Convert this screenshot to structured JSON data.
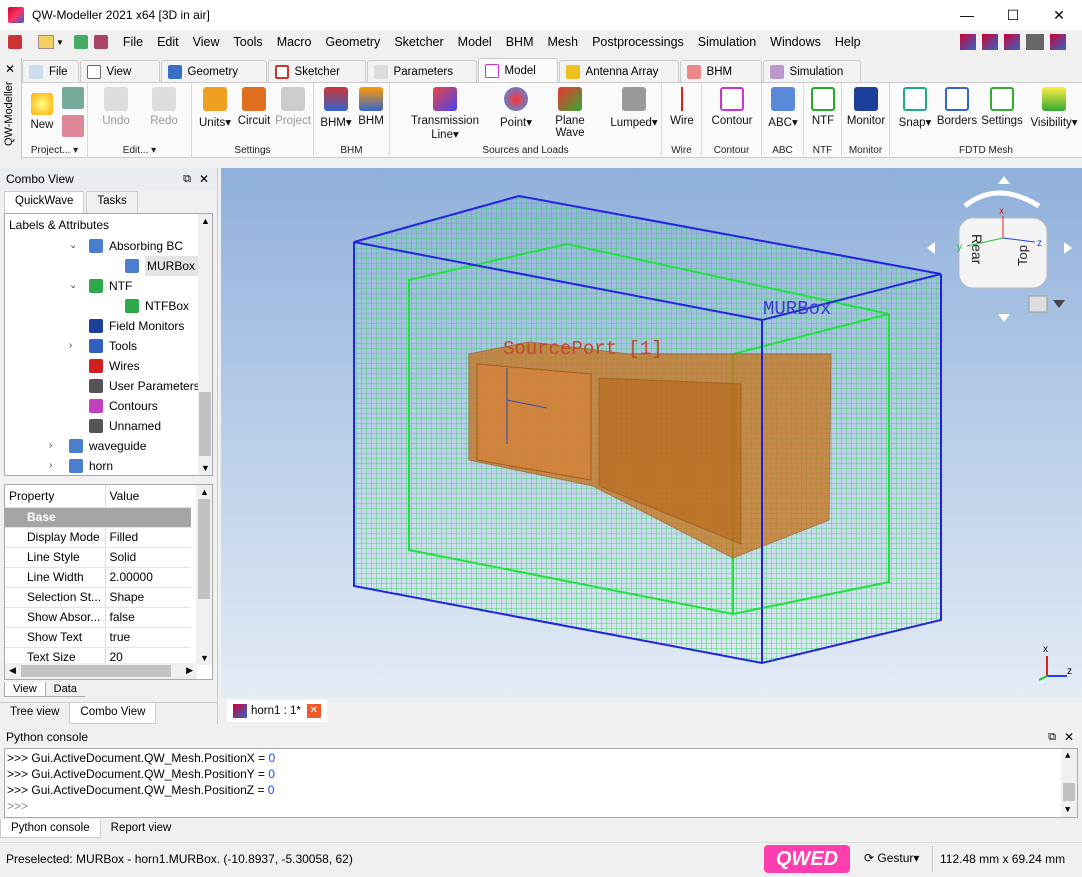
{
  "window": {
    "title": "QW-Modeller 2021 x64 [3D in air]"
  },
  "menu": [
    "File",
    "Edit",
    "View",
    "Tools",
    "Macro",
    "Geometry",
    "Sketcher",
    "Model",
    "BHM",
    "Mesh",
    "Postprocessings",
    "Simulation",
    "Windows",
    "Help"
  ],
  "ribbon_tabs": [
    "File",
    "View",
    "Geometry",
    "Sketcher",
    "Parameters",
    "Model",
    "Antenna Array",
    "BHM",
    "Simulation"
  ],
  "ribbon_active": "Model",
  "ribbon": {
    "project": {
      "new": "New",
      "label": "Project..."
    },
    "edit": {
      "undo": "Undo",
      "redo": "Redo",
      "label": "Edit..."
    },
    "settings": {
      "units": "Units",
      "circuit": "Circuit",
      "project": "Project",
      "label": "Settings"
    },
    "bhm": {
      "b1": "BHM",
      "b2": "BHM",
      "label": "BHM"
    },
    "sources": {
      "tl": "Transmission Line",
      "point": "Point",
      "plane": "Plane Wave",
      "lumped": "Lumped",
      "label": "Sources and Loads"
    },
    "wire": {
      "b": "Wire",
      "label": "Wire"
    },
    "contour": {
      "b": "Contour",
      "label": "Contour"
    },
    "abc": {
      "b": "ABC",
      "label": "ABC"
    },
    "ntf": {
      "b": "NTF",
      "label": "NTF"
    },
    "monitor": {
      "b": "Monitor",
      "label": "Monitor"
    },
    "fdtd": {
      "snap": "Snap",
      "borders": "Borders",
      "settings": "Settings",
      "visibility": "Visibility",
      "label": "FDTD Mesh"
    }
  },
  "sidebar_strip": "QW-Modeller",
  "combo": {
    "title": "Combo View",
    "tabs": [
      "QuickWave",
      "Tasks"
    ],
    "tree_header": "Labels & Attributes",
    "tree": [
      {
        "label": "Absorbing BC",
        "level": 1,
        "expanded": true,
        "color": "#4a7fd0"
      },
      {
        "label": "MURBox",
        "level": 2,
        "selected": true,
        "color": "#4a7fd0"
      },
      {
        "label": "NTF",
        "level": 1,
        "expanded": true,
        "color": "#2da84a"
      },
      {
        "label": "NTFBox",
        "level": 2,
        "color": "#2da84a"
      },
      {
        "label": "Field Monitors",
        "level": 1,
        "color": "#1c3f9a"
      },
      {
        "label": "Tools",
        "level": 1,
        "collapsed": true,
        "color": "#3060c0"
      },
      {
        "label": "Wires",
        "level": 1,
        "color": "#d02020"
      },
      {
        "label": "User Parameters",
        "level": 1,
        "color": "#555555"
      },
      {
        "label": "Contours",
        "level": 1,
        "color": "#c040c0"
      },
      {
        "label": "Unnamed",
        "level": 1,
        "color": "#555555"
      },
      {
        "label": "waveguide",
        "level": 0,
        "collapsed": true,
        "color": "#4a7fd0"
      },
      {
        "label": "horn",
        "level": 0,
        "collapsed": true,
        "color": "#4a7fd0"
      }
    ],
    "props_header": [
      "Property",
      "Value"
    ],
    "props_base": "Base",
    "props": [
      [
        "Display Mode",
        "Filled"
      ],
      [
        "Line Style",
        "Solid"
      ],
      [
        "Line Width",
        "2.00000"
      ],
      [
        "Selection St...",
        "Shape"
      ],
      [
        "Show Absor...",
        "false"
      ],
      [
        "Show Text",
        "true"
      ],
      [
        "Text Size",
        "20"
      ]
    ],
    "bottom_tabs": [
      "View",
      "Data"
    ],
    "panel_tabs": [
      "Tree view",
      "Combo View"
    ]
  },
  "viewport": {
    "label_murbox": "MURBox",
    "label_source": "SourcePort [1]",
    "navcube": {
      "rear": "Rear",
      "top": "Top"
    },
    "axes": {
      "x": "x",
      "y": "y",
      "z": "z"
    }
  },
  "document_tab": "horn1 : 1*",
  "console": {
    "title": "Python console",
    "prompt": ">>>",
    "lines": [
      {
        "code": "Gui.ActiveDocument.QW_Mesh.PositionX = ",
        "value": "0"
      },
      {
        "code": "Gui.ActiveDocument.QW_Mesh.PositionY = ",
        "value": "0"
      },
      {
        "code": "Gui.ActiveDocument.QW_Mesh.PositionZ = ",
        "value": "0"
      }
    ],
    "tabs": [
      "Python console",
      "Report view"
    ]
  },
  "status": {
    "text": "Preselected: MURBox - horn1.MURBox. (-10.8937, -5.30058, 62)",
    "logo": "QWED",
    "nav": "Gestur",
    "dims": "112.48 mm x 69.24 mm"
  }
}
